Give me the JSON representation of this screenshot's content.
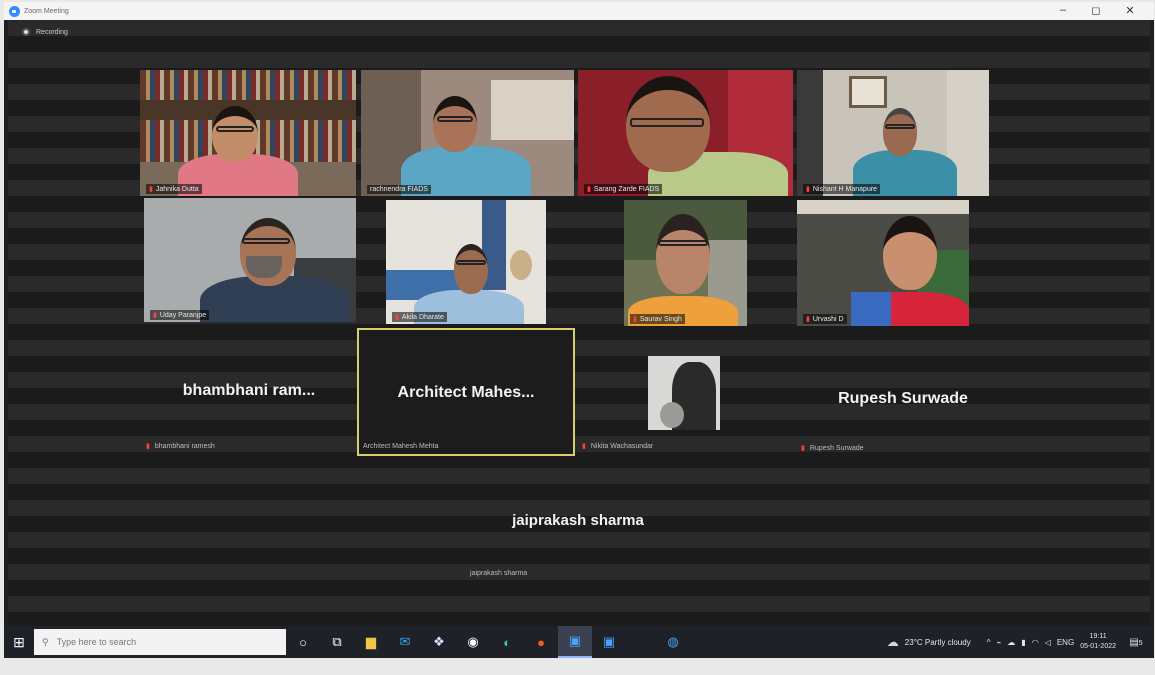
{
  "window": {
    "title": "Zoom Meeting",
    "controls": {
      "minimize": "–",
      "maximize": "◻",
      "close": "✕"
    }
  },
  "recording": {
    "label": "Recording"
  },
  "participants": [
    {
      "name": "Jahnika Dutta",
      "video": true
    },
    {
      "name": "rachnendra FIADS",
      "video": true
    },
    {
      "name": "Sarang Zarde FIADS",
      "video": true
    },
    {
      "name": "Nishant H Manapure",
      "video": true
    },
    {
      "name": "Uday Paranjpe",
      "video": true
    },
    {
      "name": "Akila Dharate",
      "video": true
    },
    {
      "name": "Saurav Singh",
      "video": true
    },
    {
      "name": "Urvashi D",
      "video": true
    },
    {
      "name": "bhambhani ramesh",
      "display": "bhambhani  ram...",
      "video": false
    },
    {
      "name": "Architect Mahesh Mehta",
      "display": "Architect  Mahes...",
      "video": false,
      "active_speaker": true
    },
    {
      "name": "Nikita Wachasundar",
      "video": false,
      "avatar_photo": true
    },
    {
      "name": "Rupesh Surwade",
      "display": "Rupesh Surwade",
      "video": false
    },
    {
      "name": "jaiprakash sharma",
      "display": "jaiprakash sharma",
      "video": false
    }
  ],
  "taskbar": {
    "search_placeholder": "Type here to search",
    "weather": "23°C  Partly cloudy",
    "language": "ENG",
    "time": "19:11",
    "date": "05-01-2022",
    "notifications": "5"
  }
}
